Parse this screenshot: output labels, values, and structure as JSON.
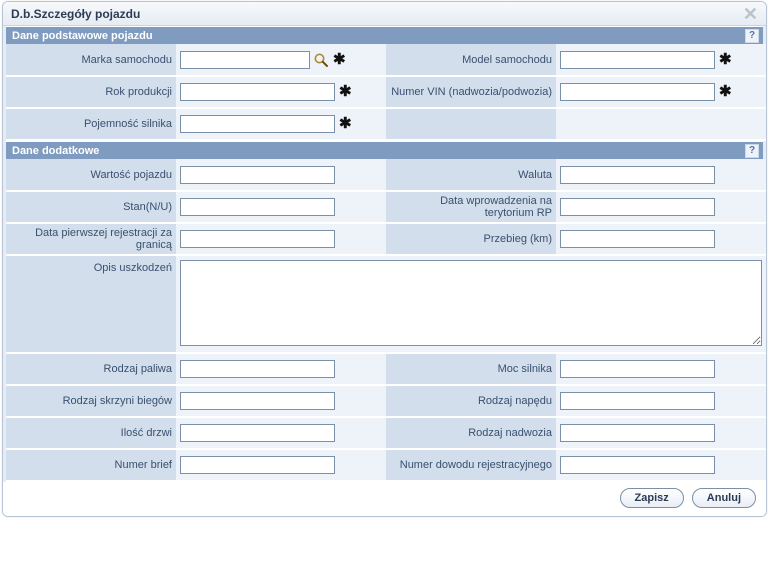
{
  "dialog": {
    "title": "D.b.Szczegóły pojazdu"
  },
  "sections": {
    "basic": {
      "title": "Dane podstawowe pojazdu"
    },
    "extra": {
      "title": "Dane dodatkowe"
    }
  },
  "labels": {
    "marka": "Marka samochodu",
    "model": "Model samochodu",
    "rok": "Rok produkcji",
    "vin": "Numer VIN (nadwozia/podwozia)",
    "pojemnosc": "Pojemność silnika",
    "wartosc": "Wartość pojazdu",
    "waluta": "Waluta",
    "stan": "Stan(N/U)",
    "data_wpr": "Data wprowadzenia na terytorium RP",
    "data_rej": "Data pierwszej rejestracji za granicą",
    "przebieg": "Przebieg (km)",
    "opis": "Opis uszkodzeń",
    "paliwo": "Rodzaj paliwa",
    "moc": "Moc silnika",
    "skrzynia": "Rodzaj skrzyni biegów",
    "naped": "Rodzaj napędu",
    "drzwi": "Ilość drzwi",
    "nadwozie": "Rodzaj nadwozia",
    "brief": "Numer brief",
    "dowod": "Numer dowodu rejestracyjnego"
  },
  "values": {
    "marka": "",
    "model": "",
    "rok": "",
    "vin": "",
    "pojemnosc": "",
    "wartosc": "",
    "waluta": "",
    "stan": "",
    "data_wpr": "",
    "data_rej": "",
    "przebieg": "",
    "opis": "",
    "paliwo": "",
    "moc": "",
    "skrzynia": "",
    "naped": "",
    "drzwi": "",
    "nadwozie": "",
    "brief": "",
    "dowod": ""
  },
  "buttons": {
    "save": "Zapisz",
    "cancel": "Anuluj"
  },
  "glyphs": {
    "required": "✱",
    "help": "?"
  }
}
